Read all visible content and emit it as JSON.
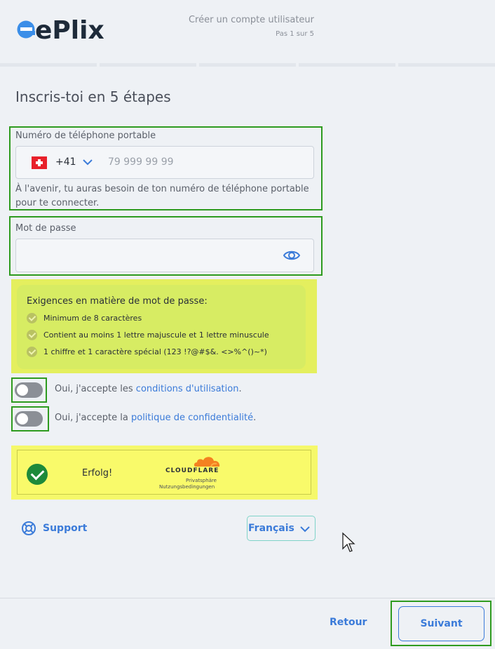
{
  "header": {
    "logo_text": "ePlix",
    "title": "Créer un compte utilisateur",
    "step": "Pas 1 sur 5"
  },
  "page_title": "Inscris-toi en 5 étapes",
  "phone": {
    "label": "Numéro de téléphone portable",
    "country_code": "+41",
    "placeholder": "79 999 99 99",
    "helper": "À l'avenir, tu auras besoin de ton numéro de téléphone portable pour te connecter."
  },
  "password": {
    "label": "Mot de passe",
    "value": ""
  },
  "requirements": {
    "title": "Exigences en matière de mot de passe:",
    "items": [
      "Minimum de 8 caractères",
      "Contient au moins 1 lettre majuscule et 1 lettre minuscule",
      "1 chiffre et 1 caractère spécial (123 !?@#$&. <>%^()~*)"
    ]
  },
  "consents": {
    "terms_prefix": "Oui, j'accepte les ",
    "terms_link": "conditions d'utilisation",
    "terms_suffix": ".",
    "privacy_prefix": "Oui, j'accepte la ",
    "privacy_link": "politique de confidentialité",
    "privacy_suffix": "."
  },
  "captcha": {
    "status": "Erfolg!",
    "brand": "CLOUDFLARE",
    "privacy_link": "Privatsphäre",
    "terms_link": "Nutzungsbedingungen"
  },
  "support_label": "Support",
  "language": "Français",
  "footer": {
    "back_label": "Retour",
    "next_label": "Suivant"
  },
  "colors": {
    "accent": "#3b7bd9",
    "logo_blue": "#3b8ee8",
    "logo_dark": "#1e2b3a",
    "highlight_green": "#2e9b1f",
    "highlight_yellow": "#e4ef5e",
    "success": "#1d8a3a",
    "cloudflare_orange": "#f48120"
  }
}
